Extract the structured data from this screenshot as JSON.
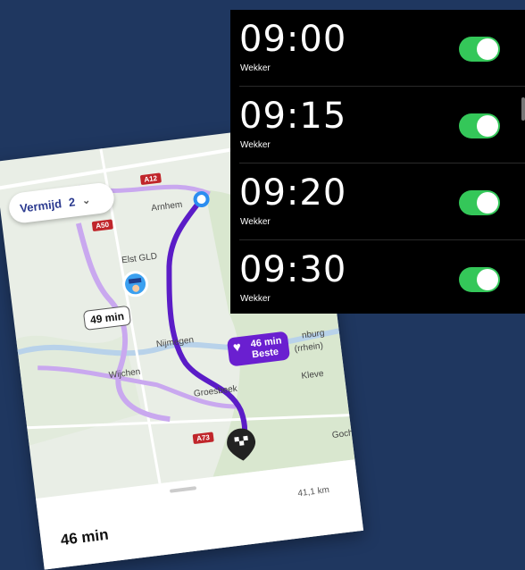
{
  "map": {
    "avoid_label": "Vermijd",
    "avoid_count": "2",
    "chevron": "⌄",
    "roads": [
      "A12",
      "A50",
      "A73"
    ],
    "places": [
      "Arnhem",
      "Elst GLD",
      "Nijmegen",
      "Wijchen",
      "Groesbeek",
      "Kleve",
      "Goch",
      "nburg",
      "(rrhein)"
    ],
    "alt_route_time": "49 min",
    "best_route_time": "46 min",
    "best_route_label": "Beste",
    "sheet_eta": "46 min",
    "sheet_distance": "41,1 km",
    "colors": {
      "route": "#5b1cc7",
      "alt_route": "#c9a8ef",
      "road": "#f6f3ea"
    }
  },
  "alarms": {
    "items": [
      {
        "time": "09:00",
        "label": "Wekker",
        "enabled": true
      },
      {
        "time": "09:15",
        "label": "Wekker",
        "enabled": true
      },
      {
        "time": "09:20",
        "label": "Wekker",
        "enabled": true
      },
      {
        "time": "09:30",
        "label": "Wekker",
        "enabled": true
      }
    ],
    "toggle_color": "#34c759"
  }
}
